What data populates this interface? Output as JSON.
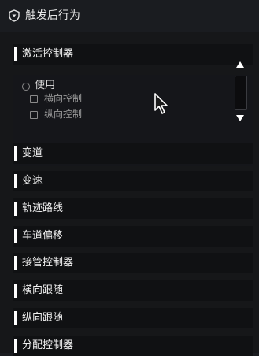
{
  "header": {
    "title": "触发后行为",
    "icon": "shield-down-icon"
  },
  "sections": [
    {
      "label": "激活控制器",
      "expanded": true
    },
    {
      "label": "变道"
    },
    {
      "label": "变速"
    },
    {
      "label": "轨迹路线"
    },
    {
      "label": "车道偏移"
    },
    {
      "label": "接管控制器"
    },
    {
      "label": "横向跟随"
    },
    {
      "label": "纵向跟随"
    },
    {
      "label": "分配控制器"
    }
  ],
  "activate_controller": {
    "use_label": "使用",
    "use_checked": false,
    "options": [
      {
        "label": "横向控制",
        "checked": false
      },
      {
        "label": "纵向控制",
        "checked": false
      }
    ]
  },
  "scrollbar": {
    "up_icon": "triangle-up-icon",
    "down_icon": "triangle-down-icon"
  }
}
